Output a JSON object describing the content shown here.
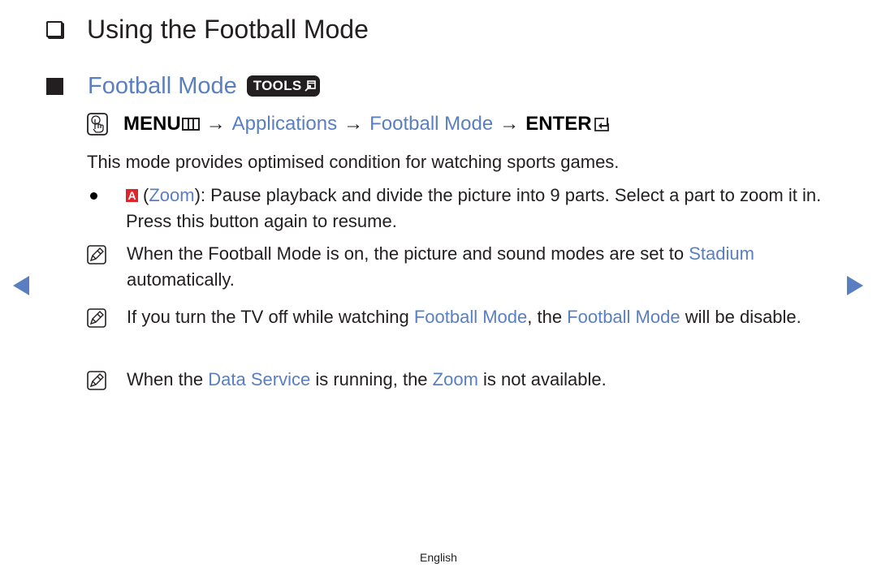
{
  "page": {
    "title": "Using the Football Mode",
    "section": {
      "heading": "Football Mode",
      "tools_badge": "TOOLS"
    },
    "menu_path": {
      "menu_label": "MENU",
      "arrow": "→",
      "steps": [
        "Applications",
        "Football Mode"
      ],
      "enter_label": "ENTER"
    },
    "intro": "This mode provides optimised condition for watching sports games.",
    "bullet": {
      "button_letter": "A",
      "open_paren": "(",
      "link": "Zoom",
      "text": "): Pause playback and divide the picture into 9 parts. Select a part to zoom it in. Press this button again to resume."
    },
    "notes": [
      {
        "t1": "When the Football Mode is on, the picture and sound modes are set to ",
        "link1": "Stadium",
        "t2": " automatically."
      },
      {
        "t1": "If you turn the TV off while watching ",
        "link1": "Football Mode",
        "t2": ", the ",
        "link2": "Football Mode",
        "t3": " will be disable."
      },
      {
        "t1": "When the ",
        "link1": "Data Service",
        "t2": " is running, the ",
        "link2": "Zoom",
        "t3": " is not available."
      }
    ],
    "footer": "English"
  },
  "colors": {
    "accent_blue": "#5a7fc0",
    "text": "#231f20",
    "red_button": "#e0242b"
  },
  "icons": {
    "title_marker": "checkbox-icon",
    "section_marker": "square-icon",
    "menu_hand": "hand-pointer-icon",
    "note": "note-pencil-icon",
    "prev": "left-triangle-icon",
    "next": "right-triangle-icon"
  }
}
